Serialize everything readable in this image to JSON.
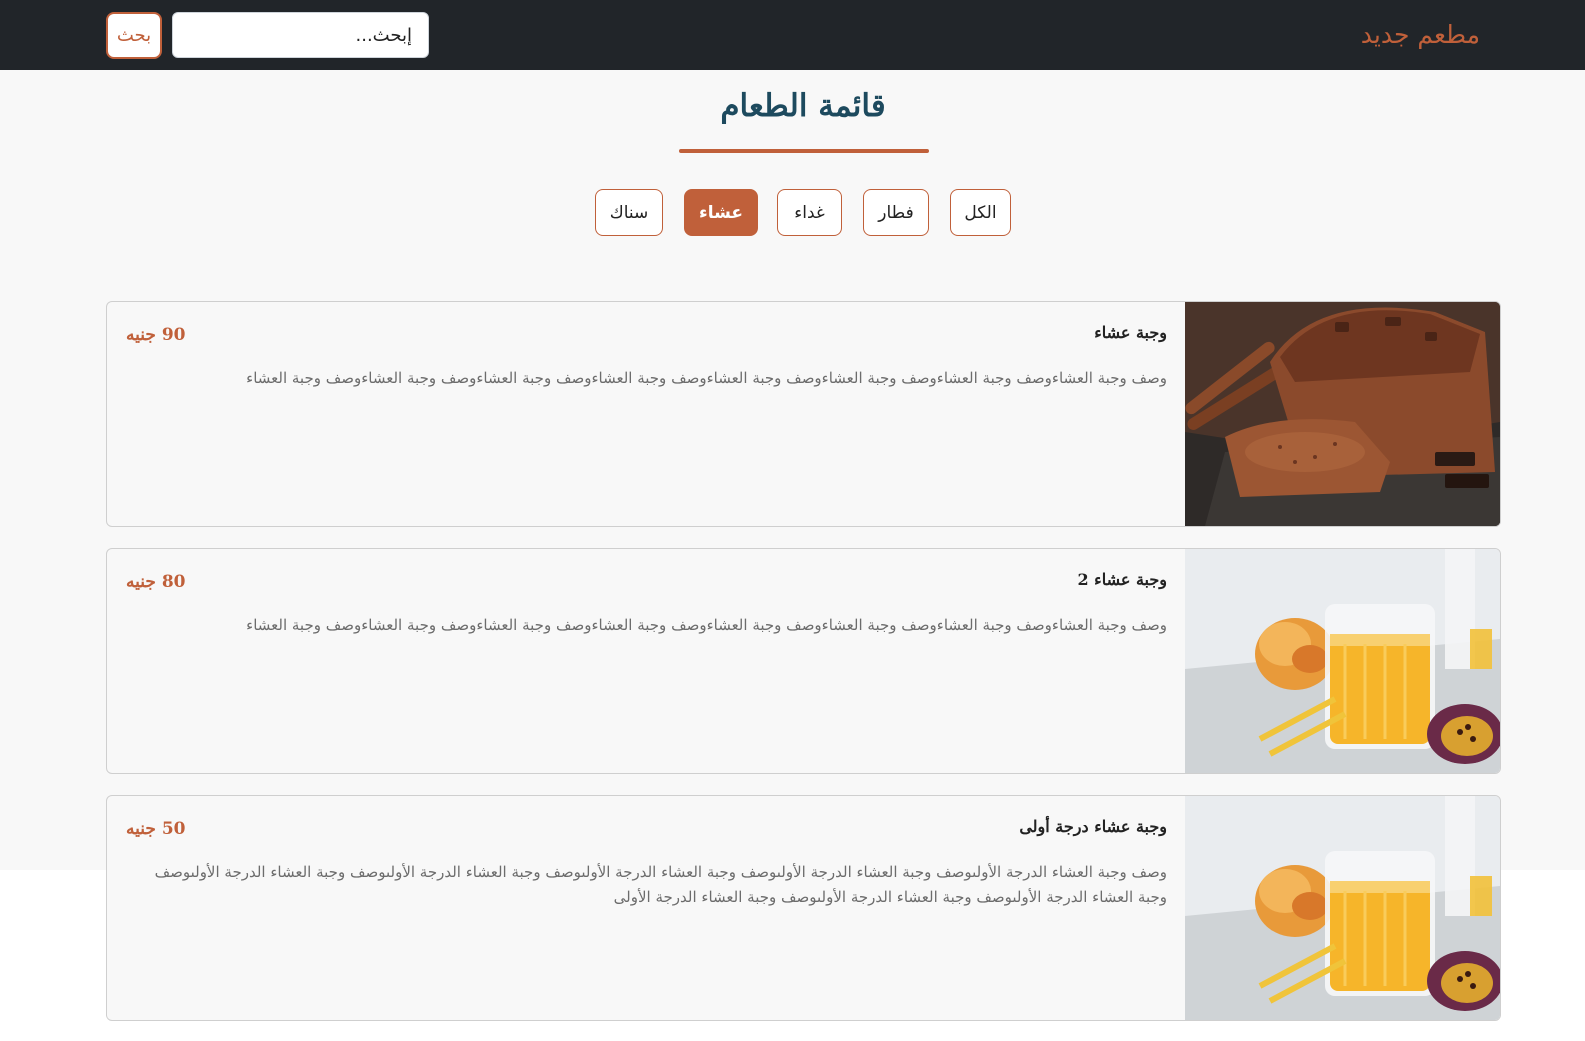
{
  "navbar": {
    "brand": "مطعم جديد",
    "search_placeholder": "إبحث...",
    "search_button": "بحث"
  },
  "menu": {
    "title": "قائمة الطعام",
    "filters": [
      {
        "label": "الكل",
        "active": false
      },
      {
        "label": "فطار",
        "active": false
      },
      {
        "label": "غداء",
        "active": false
      },
      {
        "label": "عشاء",
        "active": true
      },
      {
        "label": "سناك",
        "active": false
      }
    ]
  },
  "colors": {
    "accent": "#c0603a",
    "navbar_bg": "#212529",
    "title_color": "#1d4a5e"
  },
  "items": [
    {
      "name": "وجبة عشاء",
      "price": "90 جنيه",
      "description": "وصف وجبة العشاءوصف وجبة العشاءوصف وجبة العشاءوصف وجبة العشاءوصف وجبة العشاءوصف وجبة العشاءوصف وجبة العشاءوصف وجبة العشاء",
      "image": "chocolate-loaf-cake-image"
    },
    {
      "name": "وجبة عشاء 2",
      "price": "80 جنيه",
      "description": "وصف وجبة العشاءوصف وجبة العشاءوصف وجبة العشاءوصف وجبة العشاءوصف وجبة العشاءوصف وجبة العشاءوصف وجبة العشاءوصف وجبة العشاء",
      "image": "mango-juice-glass-image"
    },
    {
      "name": "وجبة عشاء درجة أولى",
      "price": "50 جنيه",
      "description": "وصف وجبة العشاء الدرجة الأولىوصف وجبة العشاء الدرجة الأولىوصف وجبة العشاء الدرجة الأولىوصف وجبة العشاء الدرجة الأولىوصف وجبة العشاء الدرجة الأولىوصف وجبة العشاء الدرجة الأولىوصف وجبة العشاء الدرجة الأولىوصف وجبة العشاء الدرجة الأولى",
      "image": "mango-juice-glass-image"
    }
  ]
}
